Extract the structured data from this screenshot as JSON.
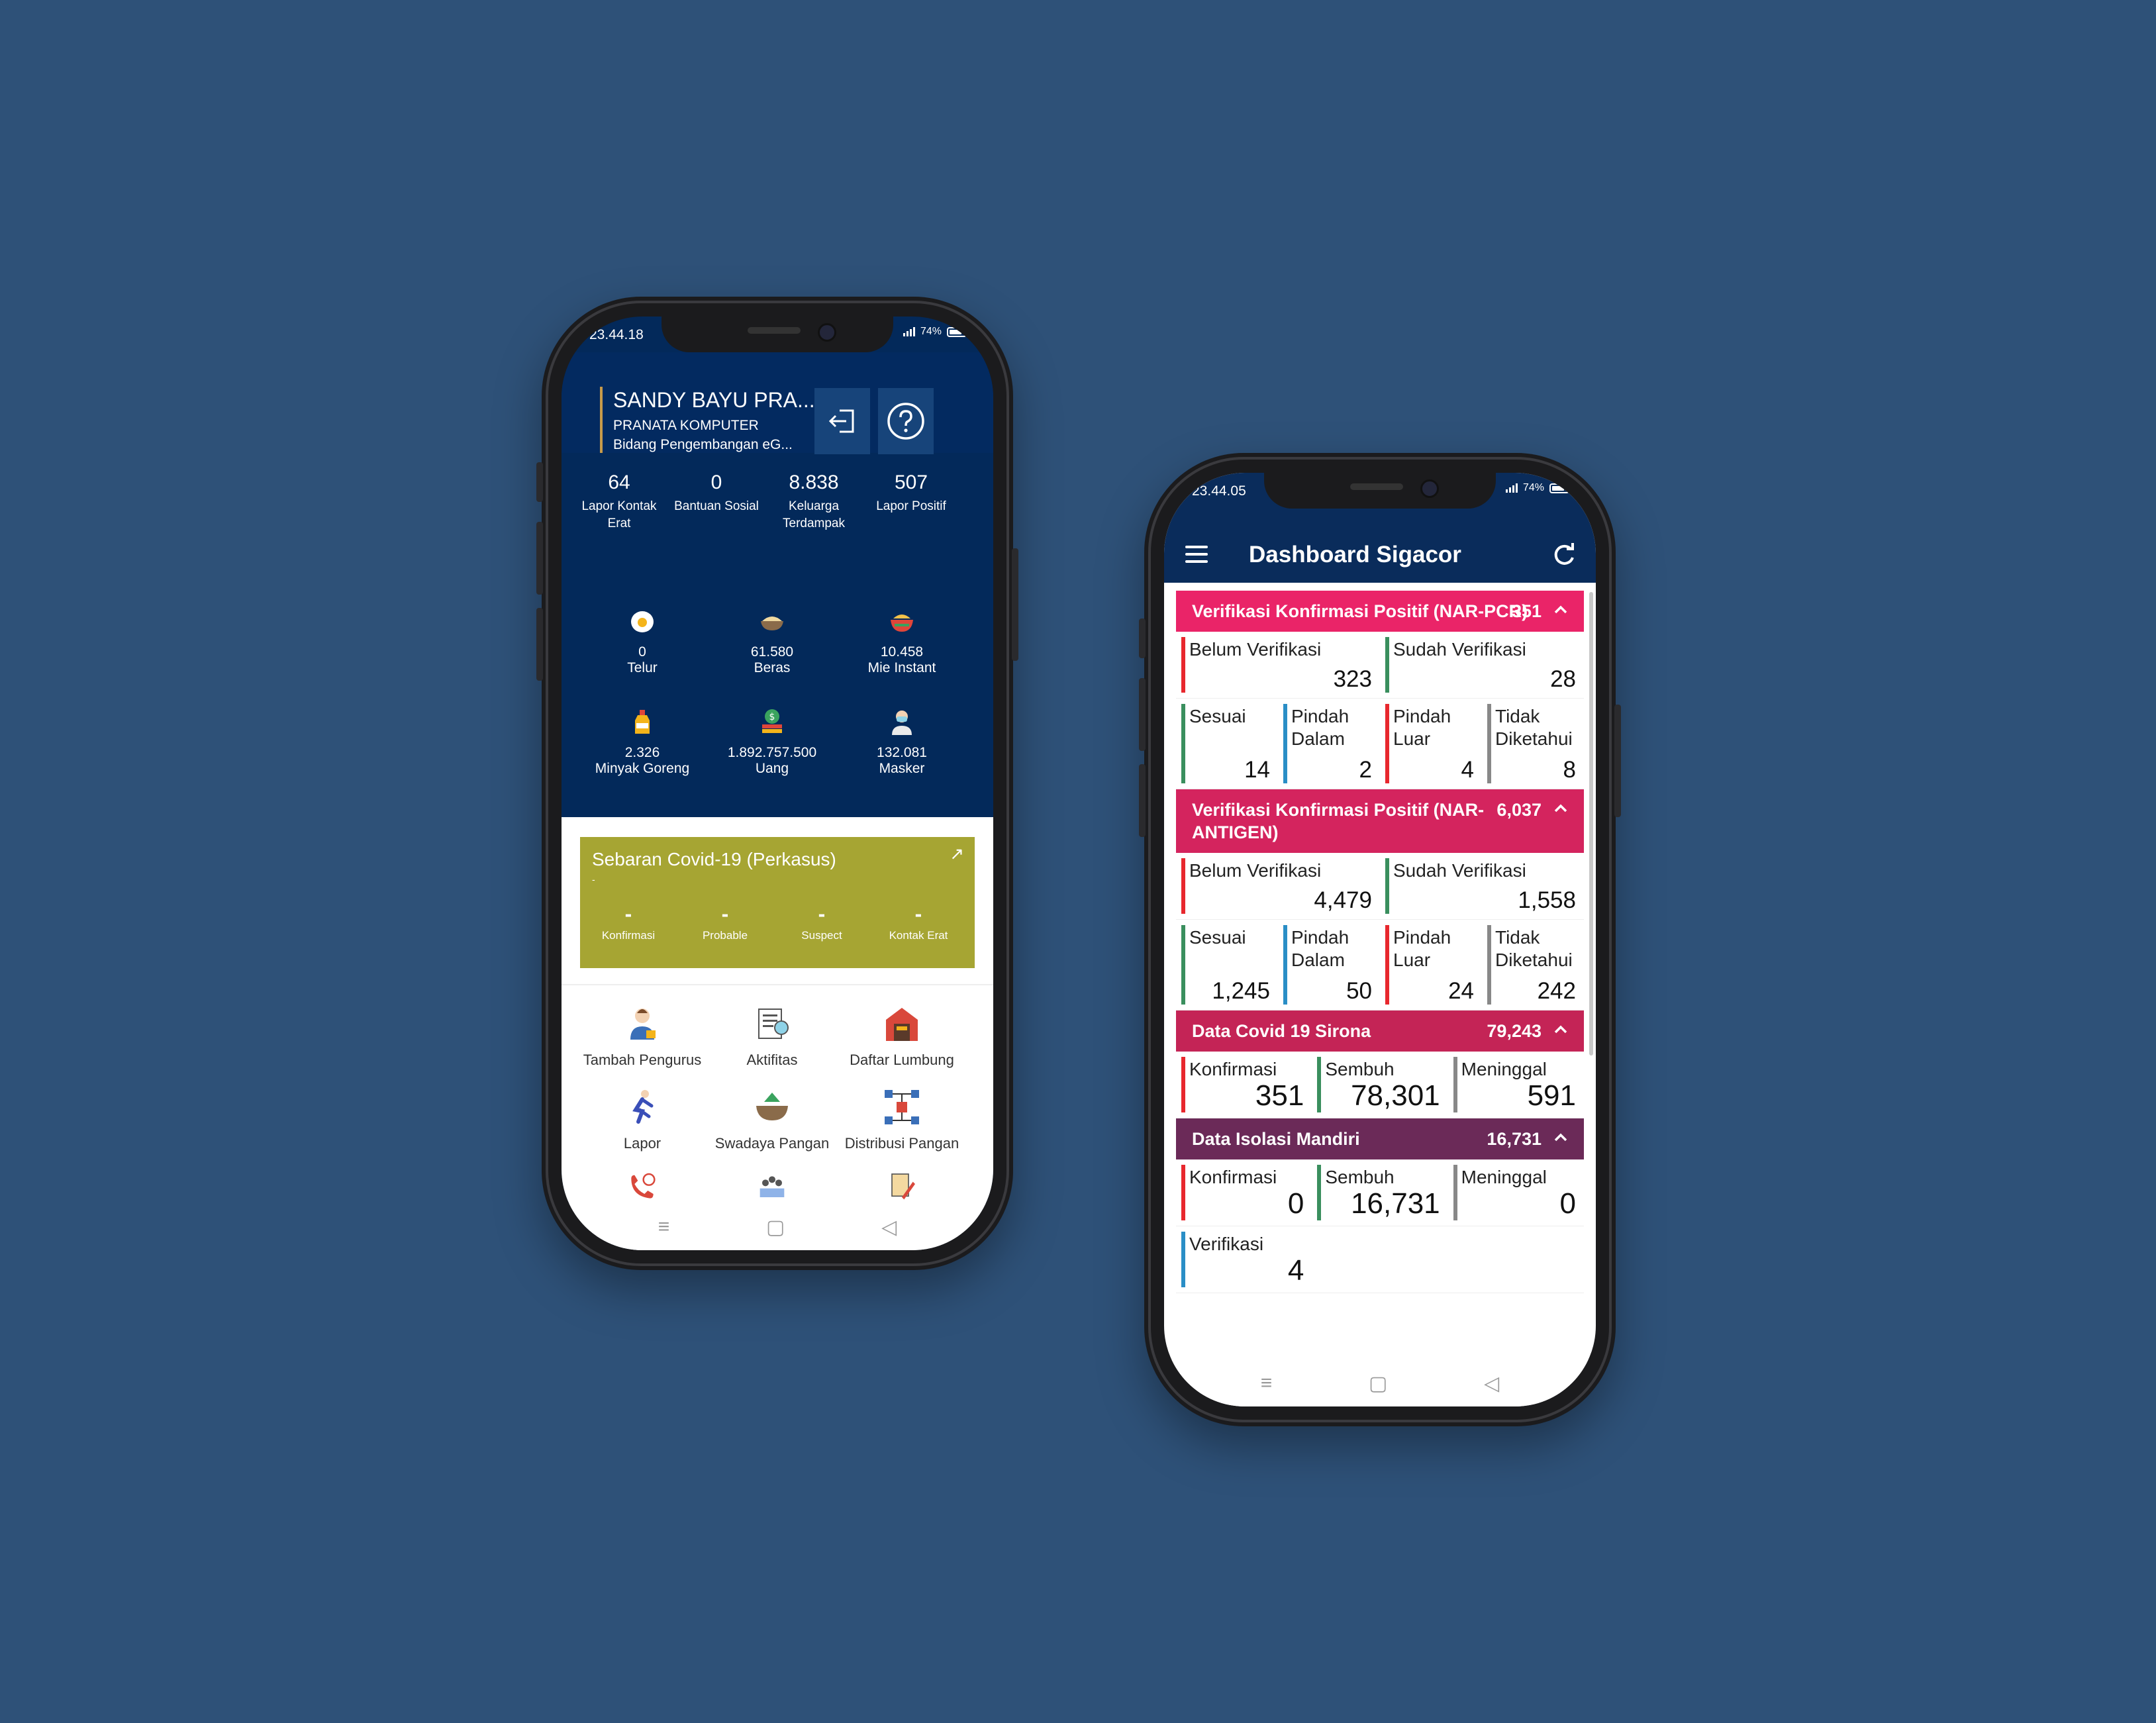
{
  "phone1": {
    "status": {
      "time": "23.44.18",
      "battery": "74%"
    },
    "user": {
      "name": "SANDY BAYU PRA...",
      "role": "PRANATA KOMPUTER",
      "unit": "Bidang Pengembangan eG..."
    },
    "stats": [
      {
        "value": "64",
        "label": "Lapor Kontak Erat"
      },
      {
        "value": "0",
        "label": "Bantuan Sosial"
      },
      {
        "value": "8.838",
        "label": "Keluarga Terdampak"
      },
      {
        "value": "507",
        "label": "Lapor Positif"
      }
    ],
    "aid": [
      {
        "value": "0",
        "label": "Telur",
        "icon": "egg-icon"
      },
      {
        "value": "61.580",
        "label": "Beras",
        "icon": "rice-icon"
      },
      {
        "value": "10.458",
        "label": "Mie Instant",
        "icon": "noodle-icon"
      },
      {
        "value": "2.326",
        "label": "Minyak Goreng",
        "icon": "oil-icon"
      },
      {
        "value": "1.892.757.500",
        "label": "Uang",
        "icon": "money-icon"
      },
      {
        "value": "132.081",
        "label": "Masker",
        "icon": "mask-icon"
      }
    ],
    "sebaran": {
      "title": "Sebaran Covid-19 (Perkasus)",
      "sub": "-",
      "cols": [
        {
          "value": "-",
          "label": "Konfirmasi"
        },
        {
          "value": "-",
          "label": "Probable"
        },
        {
          "value": "-",
          "label": "Suspect"
        },
        {
          "value": "-",
          "label": "Kontak Erat"
        }
      ]
    },
    "menu": [
      {
        "label": "Tambah Pengurus",
        "icon": "user-add-icon"
      },
      {
        "label": "Aktifitas",
        "icon": "activity-icon"
      },
      {
        "label": "Daftar Lumbung",
        "icon": "barn-icon"
      },
      {
        "label": "Lapor",
        "icon": "report-run-icon"
      },
      {
        "label": "Swadaya Pangan",
        "icon": "food-bowl-icon"
      },
      {
        "label": "Distribusi Pangan",
        "icon": "distribution-icon"
      }
    ],
    "nav": [
      "≡",
      "▢",
      "◁"
    ]
  },
  "phone2": {
    "status": {
      "time": "23.44.05",
      "battery": "74%"
    },
    "app_title": "Dashboard Sigacor",
    "colors": {
      "pcr": "#ea2468",
      "antigen": "#d4245e",
      "sirona": "#c42456",
      "isolasi": "#6b2a58"
    },
    "sections": {
      "pcr": {
        "title": "Verifikasi Konfirmasi Positif (NAR-PCR)",
        "count": "351",
        "row1": [
          {
            "label": "Belum Verifikasi",
            "value": "323"
          },
          {
            "label": "Sudah Verifikasi",
            "value": "28"
          }
        ],
        "row2": [
          {
            "label": "Sesuai",
            "value": "14"
          },
          {
            "label": "Pindah Dalam",
            "value": "2"
          },
          {
            "label": "Pindah Luar",
            "value": "4"
          },
          {
            "label": "Tidak Diketahui",
            "value": "8"
          }
        ]
      },
      "antigen": {
        "title": "Verifikasi Konfirmasi Positif (NAR-ANTIGEN)",
        "count": "6,037",
        "row1": [
          {
            "label": "Belum Verifikasi",
            "value": "4,479"
          },
          {
            "label": "Sudah Verifikasi",
            "value": "1,558"
          }
        ],
        "row2": [
          {
            "label": "Sesuai",
            "value": "1,245"
          },
          {
            "label": "Pindah Dalam",
            "value": "50"
          },
          {
            "label": "Pindah Luar",
            "value": "24"
          },
          {
            "label": "Tidak Diketahui",
            "value": "242"
          }
        ]
      },
      "sirona": {
        "title": "Data Covid 19 Sirona",
        "count": "79,243",
        "row": [
          {
            "label": "Konfirmasi",
            "value": "351"
          },
          {
            "label": "Sembuh",
            "value": "78,301"
          },
          {
            "label": "Meninggal",
            "value": "591"
          }
        ]
      },
      "isolasi": {
        "title": "Data Isolasi Mandiri",
        "count": "16,731",
        "row": [
          {
            "label": "Konfirmasi",
            "value": "0"
          },
          {
            "label": "Sembuh",
            "value": "16,731"
          },
          {
            "label": "Meninggal",
            "value": "0"
          }
        ],
        "extra": {
          "label": "Verifikasi",
          "value": "4"
        }
      }
    },
    "nav": [
      "≡",
      "▢",
      "◁"
    ]
  }
}
